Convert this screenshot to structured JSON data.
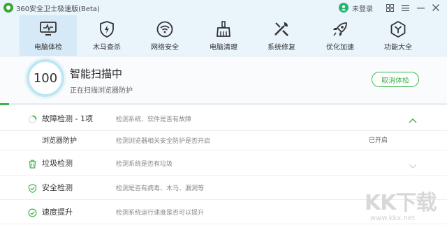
{
  "window": {
    "title": "360安全卫士极速版(Beta)",
    "user_label": "未登录",
    "controls": [
      "skin-icon",
      "menu-icon",
      "minimize-icon",
      "close-icon"
    ]
  },
  "nav": {
    "tabs": [
      {
        "label": "电脑体检",
        "icon": "monitor-icon",
        "active": true
      },
      {
        "label": "木马查杀",
        "icon": "shield-bolt-icon",
        "active": false
      },
      {
        "label": "网络安全",
        "icon": "wifi-icon",
        "active": false
      },
      {
        "label": "电脑清理",
        "icon": "broom-icon",
        "active": false
      },
      {
        "label": "系统修复",
        "icon": "wrench-icon",
        "active": false
      },
      {
        "label": "优化加速",
        "icon": "rocket-icon",
        "active": false
      },
      {
        "label": "功能大全",
        "icon": "hexagon-icon",
        "active": false
      }
    ]
  },
  "scan": {
    "score": "100",
    "title": "智能扫描中",
    "subtitle": "正在扫描浏览器防护",
    "cancel_label": "取消体检",
    "progress": 0.02
  },
  "items": [
    {
      "title": "故障检测 - 1项",
      "desc": "检测系统、软件是否有故障",
      "icon": "spinner-icon",
      "expanded": true
    },
    {
      "title": "垃圾检测",
      "desc": "检测系统是否有垃圾",
      "icon": "trash-icon",
      "expanded": false
    },
    {
      "title": "安全检测",
      "desc": "检测是否有病毒、木马、漏洞等",
      "icon": "shield-check-icon",
      "expanded": false
    },
    {
      "title": "速度提升",
      "desc": "检测系统运行速度是否可以提升",
      "icon": "speedometer-icon",
      "expanded": false
    }
  ],
  "subitem": {
    "title": "浏览器防护",
    "desc": "检测浏览器相关安全防护是否开启",
    "status": "已开启"
  },
  "watermark": {
    "text": "KK下载",
    "url": "www.kkx.net"
  },
  "colors": {
    "accent": "#3bb54a",
    "nav_bg": "#eaf4fb",
    "nav_active": "#d6e9f6"
  }
}
